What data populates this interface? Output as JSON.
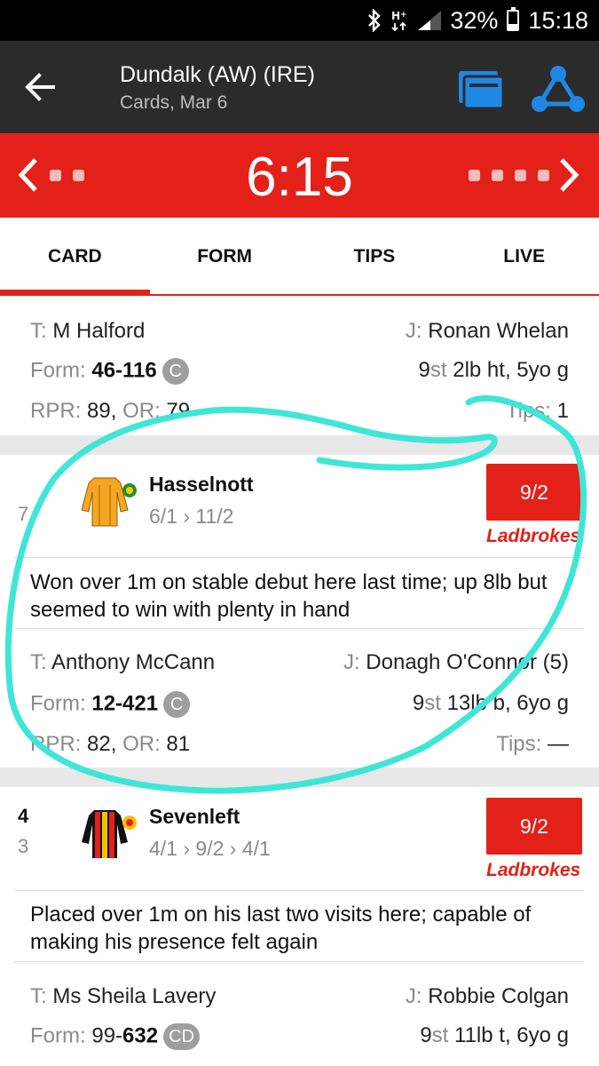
{
  "status_bar": {
    "battery": "32%",
    "battery_level": 0.32,
    "time": "15:18",
    "bluetooth_icon": "bluetooth-icon",
    "network_icon": "signal-icon"
  },
  "app_bar": {
    "title": "Dundalk (AW) (IRE)",
    "subtitle": "Cards, Mar 6",
    "back_icon": "arrow-left-icon",
    "cards_icon": "race-cards-icon",
    "share_icon": "share-icon"
  },
  "race_bar": {
    "time": "6:15",
    "color": "#e32119"
  },
  "tabs": [
    {
      "label": "CARD",
      "active": true
    },
    {
      "label": "FORM",
      "active": false
    },
    {
      "label": "TIPS",
      "active": false
    },
    {
      "label": "LIVE",
      "active": false
    }
  ],
  "entry_top": {
    "trainer_label": "T:",
    "trainer": "M Halford",
    "jockey_label": "J:",
    "jockey": "Ronan Whelan",
    "form_label": "Form:",
    "form": "46-116",
    "form_badge": "C",
    "weight_st": "9",
    "weight_rest": "2lb ht, 5yo g",
    "rpr_label": "RPR:",
    "rpr": "89",
    "or_label": "OR:",
    "or": "79",
    "tips_label": "Tips:",
    "tips": "1"
  },
  "runners": [
    {
      "number": "",
      "draw": "7",
      "name": "Hasselnott",
      "odds_trail": "6/1 › 11/2",
      "price": "9/2",
      "bookmaker": "Ladbrokes",
      "comment": "Won over 1m on stable debut here last time; up 8lb but seemed to win with plenty in hand",
      "trainer_label": "T:",
      "trainer": "Anthony McCann",
      "jockey_label": "J:",
      "jockey": "Donagh O'Connor (5)",
      "form_label": "Form:",
      "form": "12-421",
      "form_badge": "C",
      "weight_st": "9",
      "weight_rest": "13lb b, 6yo g",
      "rpr_label": "RPR:",
      "rpr": "82",
      "or_label": "OR:",
      "or": "81",
      "tips_label": "Tips:",
      "tips": "—",
      "silks_colors": [
        "#f5a623",
        "#2e8b2e",
        "#f2d100"
      ]
    },
    {
      "number": "4",
      "draw": "3",
      "name": "Sevenleft",
      "odds_trail": "4/1 › 9/2 › 4/1",
      "price": "9/2",
      "bookmaker": "Ladbrokes",
      "comment": "Placed over 1m on his last two visits here; capable of making his presence felt again",
      "trainer_label": "T:",
      "trainer": "Ms Sheila Lavery",
      "jockey_label": "J:",
      "jockey": "Robbie Colgan",
      "form_label": "Form:",
      "form_plain": "99-",
      "form": "632",
      "form_badge": "CD",
      "weight_st": "9",
      "weight_rest": "11lb t, 6yo g",
      "silks_colors": [
        "#e32119",
        "#f2c200",
        "#111111"
      ]
    }
  ],
  "annotation": {
    "color": "#3fe6d8"
  }
}
